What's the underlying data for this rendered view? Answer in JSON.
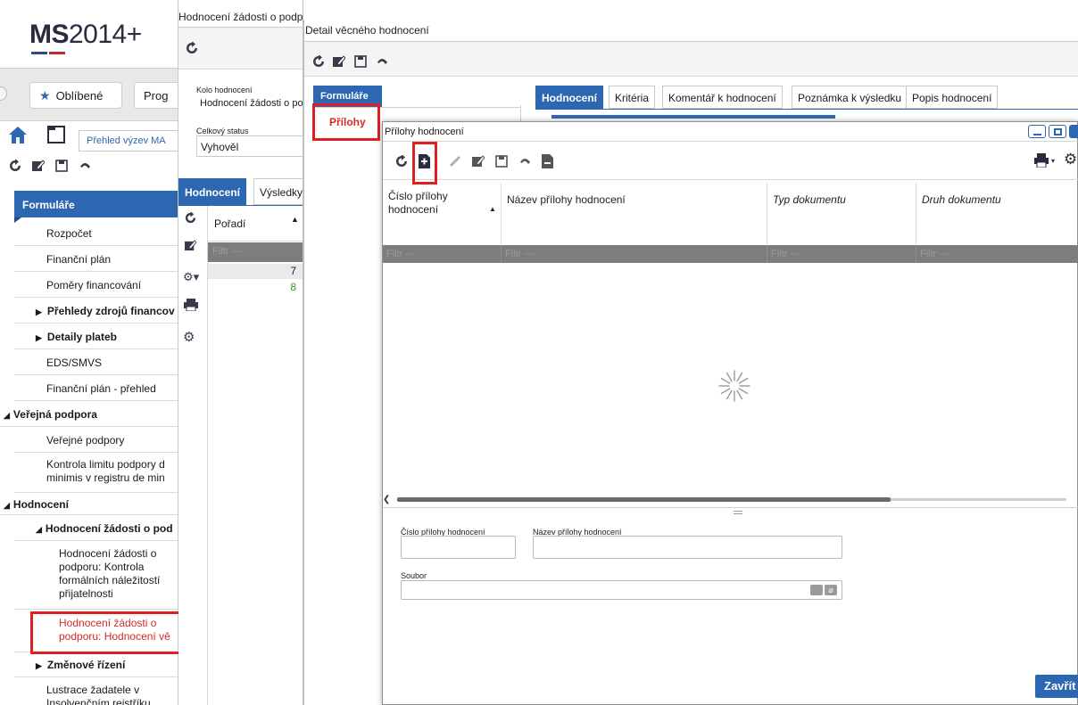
{
  "logo": {
    "text_bold": "MS",
    "text_rest": "2014+"
  },
  "left": {
    "favorites_label": "Oblíbené",
    "program_label": "Prog",
    "overview_label": "Přehled výzev MA",
    "menu_title": "Formuláře",
    "items": [
      "Rozpočet",
      "Finanční plán",
      "Poměry financování",
      "Přehledy zdrojů financov",
      "Detaily plateb",
      "EDS/SMVS",
      "Finanční plán - přehled",
      "Veřejná podpora",
      "Veřejné podpory",
      "Kontrola limitu podpory d",
      "minimis v registru de min",
      "Hodnocení",
      "Hodnocení žádosti o pod",
      "Hodnocení žádosti o",
      "podporu: Kontrola",
      "formálních náležitostí",
      "přijatelnosti",
      "Hodnocení žádosti o",
      "podporu: Hodnocení vě",
      "Změnové řízení",
      "Lustrace žadatele v",
      "Insolvenčním rejstříku"
    ]
  },
  "mid": {
    "window_title": "Hodnocení žádosti o podporu: Hodnocení věcné",
    "kolo_label": "Kolo hodnocení",
    "kolo_value": "Hodnocení žádosti o po",
    "status_label": "Celkový status",
    "status_value": "Vyhověl",
    "tab_hodnoceni": "Hodnocení",
    "tab_vysledky": "Výsledky",
    "col_poradi": "Pořadí",
    "filter_placeholder": "Filtr ---",
    "rows": [
      "7",
      "8"
    ]
  },
  "detail": {
    "title": "Detail věcného hodnocení",
    "side_tab": "Formuláře",
    "side_item": "Přílohy",
    "tabs": [
      "Hodnocení",
      "Kritéria",
      "Komentář k hodnocení",
      "Poznámka k výsledku",
      "Popis hodnocení"
    ]
  },
  "modal": {
    "title": "Přílohy hodnocení",
    "columns": [
      "Číslo přílohy hodnocení",
      "Název přílohy hodnocení",
      "Typ dokumentu",
      "Druh dokumentu"
    ],
    "filter_placeholder": "Filtr ---",
    "form": {
      "cislo_label": "Číslo přílohy hodnocení",
      "nazev_label": "Název přílohy hodnocení",
      "soubor_label": "Soubor",
      "cislo_value": "",
      "nazev_value": "",
      "soubor_value": ""
    },
    "close_label": "Zavřít"
  },
  "colors": {
    "accent": "#2e67b1",
    "highlight": "#e02020",
    "link_red": "#d42a2a",
    "green": "#3f9a1a"
  }
}
